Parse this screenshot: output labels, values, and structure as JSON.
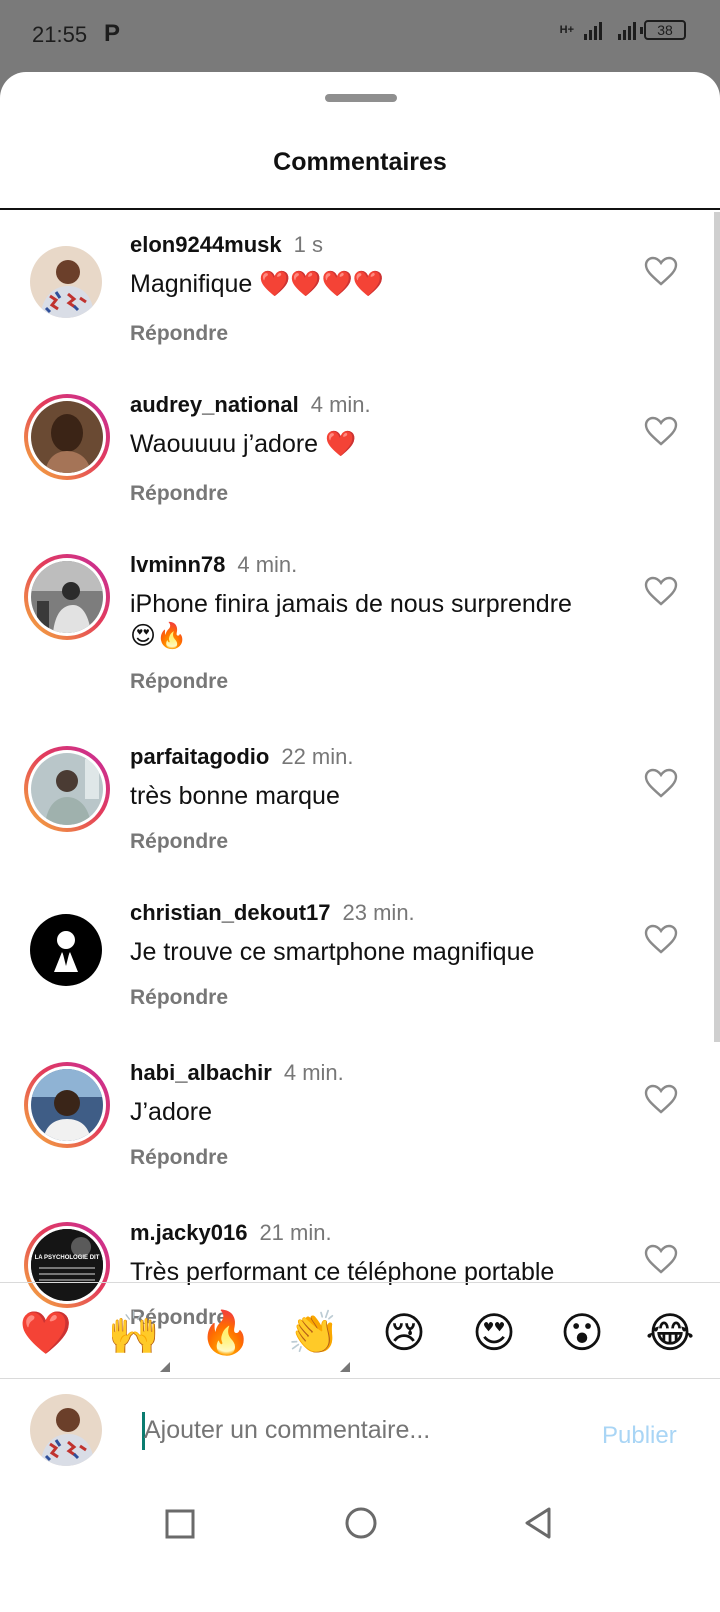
{
  "status_bar": {
    "time": "21:55",
    "app_indicator": "P",
    "network": "H+",
    "battery": "38"
  },
  "sheet": {
    "title": "Commentaires"
  },
  "comments": [
    {
      "username": "elon9244musk",
      "time": "1 s",
      "text": "Magnifique ❤️❤️❤️❤️",
      "reply_label": "Répondre"
    },
    {
      "username": "audrey_national",
      "time": "4 min.",
      "text": "Waouuuu j’adore ❤️",
      "reply_label": "Répondre"
    },
    {
      "username": "lvminn78",
      "time": "4 min.",
      "text": "iPhone finira jamais de nous surprendre 😍🔥",
      "reply_label": "Répondre"
    },
    {
      "username": "parfaitagodio",
      "time": "22 min.",
      "text": "très bonne marque",
      "reply_label": "Répondre"
    },
    {
      "username": "christian_dekout17",
      "time": "23 min.",
      "text": "Je trouve ce smartphone magnifique",
      "reply_label": "Répondre"
    },
    {
      "username": "habi_albachir",
      "time": "4 min.",
      "text": "J’adore",
      "reply_label": "Répondre"
    },
    {
      "username": "m.jacky016",
      "time": "21 min.",
      "text": "Très performant ce téléphone portable",
      "reply_label": "Répondre"
    }
  ],
  "avatar_text": {
    "jacky": "LA PSYCHOLOGIE DIT"
  },
  "emoji_bar": [
    "❤️",
    "🙌",
    "🔥",
    "👏",
    "😢",
    "😍",
    "😮",
    "😂"
  ],
  "composer": {
    "placeholder": "Ajouter un commentaire...",
    "publish_label": "Publier"
  },
  "nav": {
    "icons": [
      "recents-square-icon",
      "home-circle-icon",
      "back-triangle-icon"
    ]
  },
  "colors": {
    "accent_ring_start": "#f5b33c",
    "accent_ring_end": "#c32aa3",
    "publish_disabled": "#a9d5f5",
    "heart_red": "#e0242f"
  }
}
